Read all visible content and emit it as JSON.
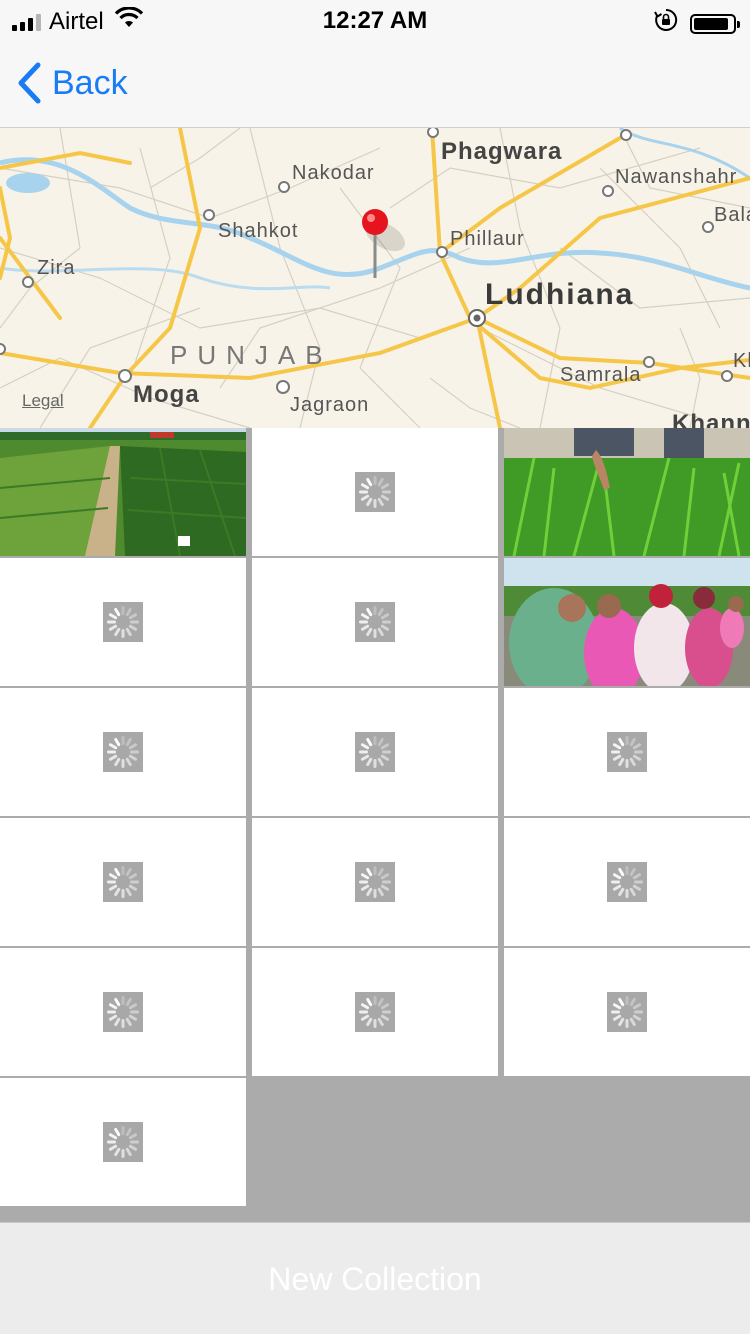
{
  "status_bar": {
    "carrier": "Airtel",
    "time": "12:27 AM",
    "signal_bars": 4,
    "signal_active": 3,
    "icons": [
      "signal-icon",
      "wifi-icon",
      "orientation-lock-icon",
      "battery-icon"
    ]
  },
  "nav": {
    "back_label": "Back",
    "back_icon": "chevron-left-icon"
  },
  "map": {
    "labels": {
      "nakodar": "Nakodar",
      "phagwara": "Phagwara",
      "nawanshahr": "Nawanshahr",
      "bala": "Bala",
      "shahkot": "Shahkot",
      "phillaur": "Phillaur",
      "zira": "Zira",
      "ludhiana": "Ludhiana",
      "punjab": "PUNJAB",
      "moga": "Moga",
      "jagraon": "Jagraon",
      "samrala": "Samrala",
      "kh": "Kh",
      "khanna": "Khann"
    },
    "legal": "Legal",
    "pin_icon": "map-pin-icon",
    "colors": {
      "land": "#f8f3e8",
      "road": "#f6c648",
      "water": "#a7d3ee",
      "pin": "#e6141c"
    }
  },
  "photos": {
    "items": [
      {
        "state": "image",
        "subject": "wheat-field-plots"
      },
      {
        "state": "loading"
      },
      {
        "state": "image",
        "subject": "green-wheat-hand"
      },
      {
        "state": "loading"
      },
      {
        "state": "loading"
      },
      {
        "state": "image",
        "subject": "women-group-field"
      },
      {
        "state": "loading"
      },
      {
        "state": "loading"
      },
      {
        "state": "loading"
      },
      {
        "state": "loading"
      },
      {
        "state": "loading"
      },
      {
        "state": "loading"
      },
      {
        "state": "loading"
      },
      {
        "state": "loading"
      },
      {
        "state": "loading"
      },
      {
        "state": "loading"
      }
    ]
  },
  "toolbar": {
    "new_collection_label": "New Collection"
  }
}
